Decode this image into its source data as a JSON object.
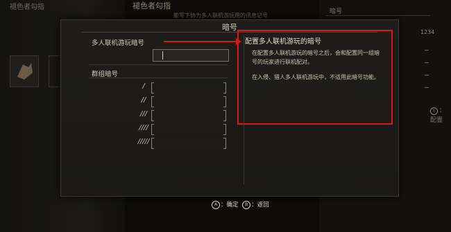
{
  "background": {
    "left_title": "褪色者勾指",
    "mid_title": "褪色者勾指",
    "mid_subtitle": "能写下协力多人联机游玩用的讯息记号",
    "right_header": "暗号",
    "right_value": "1234",
    "config_button_glyph": "Y",
    "config_label": "：配置"
  },
  "dialog": {
    "title": "暗号",
    "multiplayer_label": "多人联机游玩暗号",
    "multiplayer_value": "",
    "group_label": "群组暗号",
    "group_slots": [
      {
        "symbol": "/",
        "value": ""
      },
      {
        "symbol": "//",
        "value": ""
      },
      {
        "symbol": "///",
        "value": ""
      },
      {
        "symbol": "////",
        "value": ""
      },
      {
        "symbol": "/////",
        "value": ""
      }
    ]
  },
  "info": {
    "title": "配置多人联机游玩的暗号",
    "paragraph1": "在配置多人联机游玩的暗号之后，会和配置同一组暗号的玩家进行联机配对。",
    "paragraph2": "在入侵、猎人多人联机游玩中，不适用此暗号功能。"
  },
  "footer": {
    "confirm_glyph": "A",
    "confirm_label": "：确定",
    "back_glyph": "B",
    "back_label": "：返回"
  },
  "colors": {
    "highlight_red": "#e11515",
    "text": "#d8d2c4",
    "panel_bg": "#1e1d1b"
  }
}
